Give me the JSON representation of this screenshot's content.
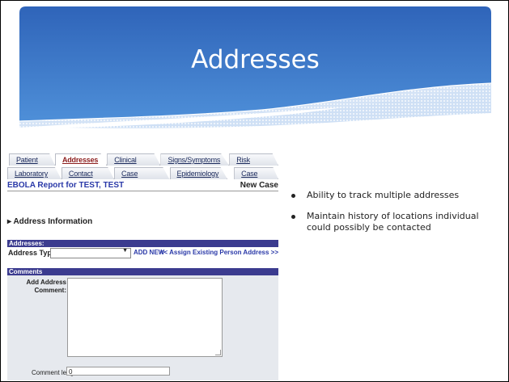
{
  "slide_title": "Addresses",
  "tabs_row1": [
    "Patient Info",
    "Addresses",
    "Clinical Status",
    "Signs/Symptoms",
    "Risk Factors"
  ],
  "tabs_row2": [
    "Laboratory Eval.",
    "Contact Tracing",
    "Case Comments",
    "Epidemiology",
    "Case Class."
  ],
  "report": {
    "prefix": "EBOLA Report for",
    "patient": "TEST, TEST",
    "status": "New Case"
  },
  "section_header": "Address Information",
  "addresses_bar": "Addresses:",
  "address_type_label": "Address Type:",
  "add_new": "ADD NEW",
  "assign_link": "<< Assign Existing Person Address >>",
  "comments_bar": "Comments",
  "comment_label_1": "Add Address",
  "comment_label_2": "Comment:",
  "comment_length_label": "Comment length:",
  "comment_length_value": "0",
  "bullets": [
    "Ability to track multiple addresses",
    "Maintain history of locations individual could possibly be contacted"
  ],
  "colors": {
    "header_blue": "#3c6fc2",
    "form_bar": "#3b3b8f",
    "link_blue": "#2a39a8"
  }
}
